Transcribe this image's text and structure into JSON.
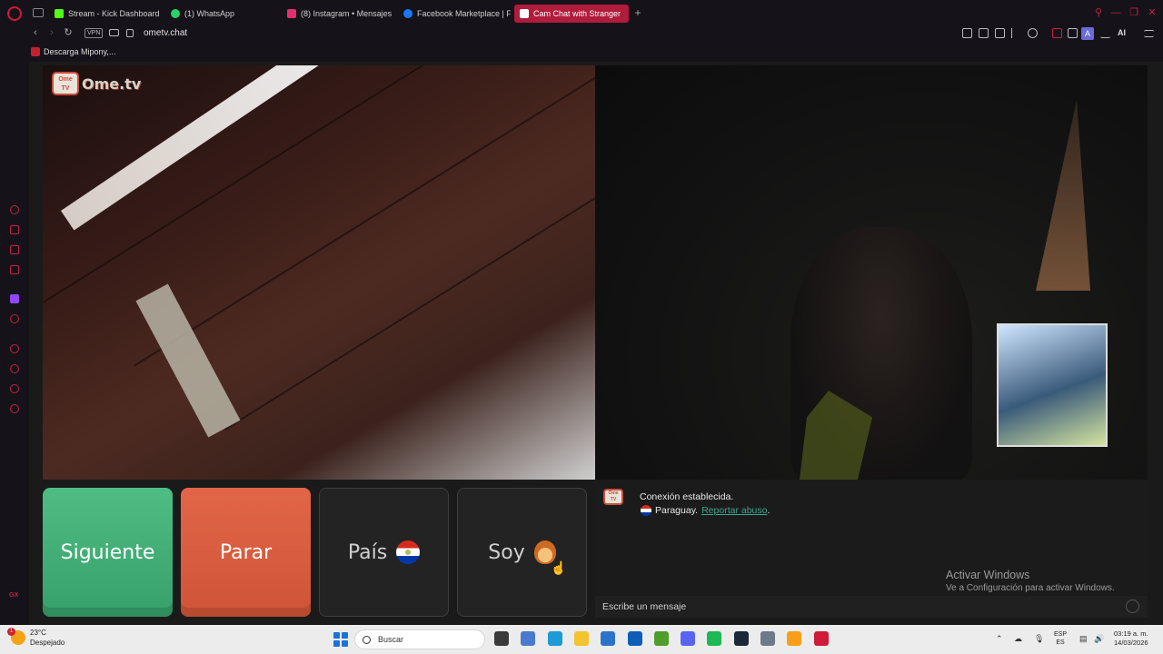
{
  "browser": {
    "tabs": [
      {
        "label": "Stream - Kick Dashboard",
        "color": "#53fc18"
      },
      {
        "label": "(1) WhatsApp",
        "color": "#25d366"
      },
      {
        "label": "(8) Instagram • Mensajes",
        "color": "#e1306c"
      },
      {
        "label": "Facebook Marketplace | F",
        "color": "#1877f2"
      },
      {
        "label": "Cam Chat with Stranger",
        "color": "#ffffff"
      }
    ],
    "url": "ometv.chat",
    "vpn_label": "VPN",
    "ai_label": "AI",
    "account_initial": "A",
    "bookmark": "Descarga Mipony,..."
  },
  "sidebar": {
    "gx_label": "GX"
  },
  "site": {
    "logo_badge": "Ome TV",
    "logo_text": "Ome.tv",
    "buttons": {
      "next": "Siguiente",
      "stop": "Parar",
      "country": "País",
      "gender": "Soy"
    },
    "chat": {
      "logo_badge": "Ome TV",
      "connected": "Conexión establecida.",
      "country": "Paraguay.",
      "report_link": "Reportar abuso",
      "report_suffix": ".",
      "input_placeholder": "Escribe un mensaje"
    },
    "watermark": {
      "title": "Activar Windows",
      "subtitle": "Ve a Configuración para activar Windows."
    }
  },
  "taskbar": {
    "weather_badge": "1",
    "temperature": "23°C",
    "condition": "Despejado",
    "search_placeholder": "Buscar",
    "language_top": "ESP",
    "language_bottom": "ES",
    "time": "03:19 a. m.",
    "date": "14/03/2026",
    "apps": [
      {
        "name": "task-view",
        "color": "#3a3a3a"
      },
      {
        "name": "photos",
        "color": "#4a7ad0"
      },
      {
        "name": "edge",
        "color": "#1e9ad6"
      },
      {
        "name": "file-explorer",
        "color": "#f3c330"
      },
      {
        "name": "store",
        "color": "#2a73c9"
      },
      {
        "name": "outlook",
        "color": "#0f5fb8"
      },
      {
        "name": "minecraft",
        "color": "#4f9d2d"
      },
      {
        "name": "discord",
        "color": "#5865f2"
      },
      {
        "name": "spotify",
        "color": "#1db954"
      },
      {
        "name": "steam",
        "color": "#1b2838"
      },
      {
        "name": "settings",
        "color": "#6c7a89"
      },
      {
        "name": "overwatch",
        "color": "#f99e1a"
      },
      {
        "name": "opera-gx",
        "color": "#d01a3a"
      }
    ]
  }
}
